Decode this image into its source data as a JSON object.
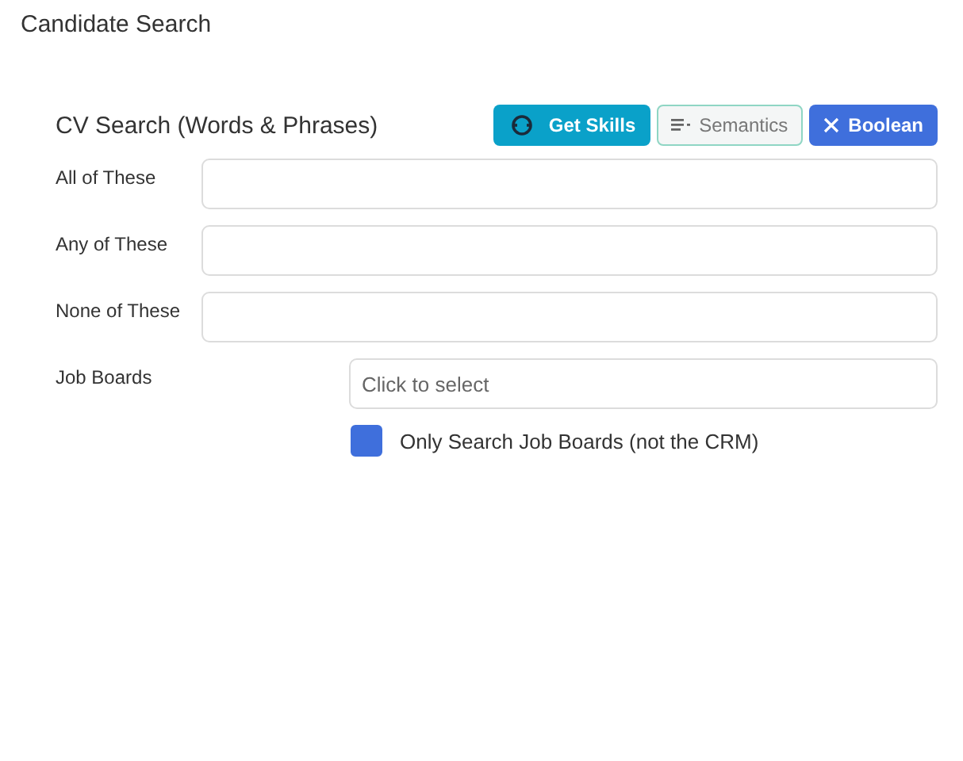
{
  "page_title": "Candidate Search",
  "section_title": "CV Search (Words & Phrases)",
  "buttons": [
    {
      "label": "Get Skills",
      "kind": "skills"
    },
    {
      "label": "Semantics",
      "kind": "semantics"
    },
    {
      "label": "Boolean",
      "kind": "boolean"
    }
  ],
  "fields": [
    {
      "label": "All of These"
    },
    {
      "label": "Any of These"
    },
    {
      "label": "None of These"
    }
  ],
  "job_boards": {
    "label": "Job Boards",
    "placeholder": "Click to select"
  },
  "only_job_boards": {
    "label": "Only Search Job Boards (not the CRM)",
    "checked": true
  }
}
